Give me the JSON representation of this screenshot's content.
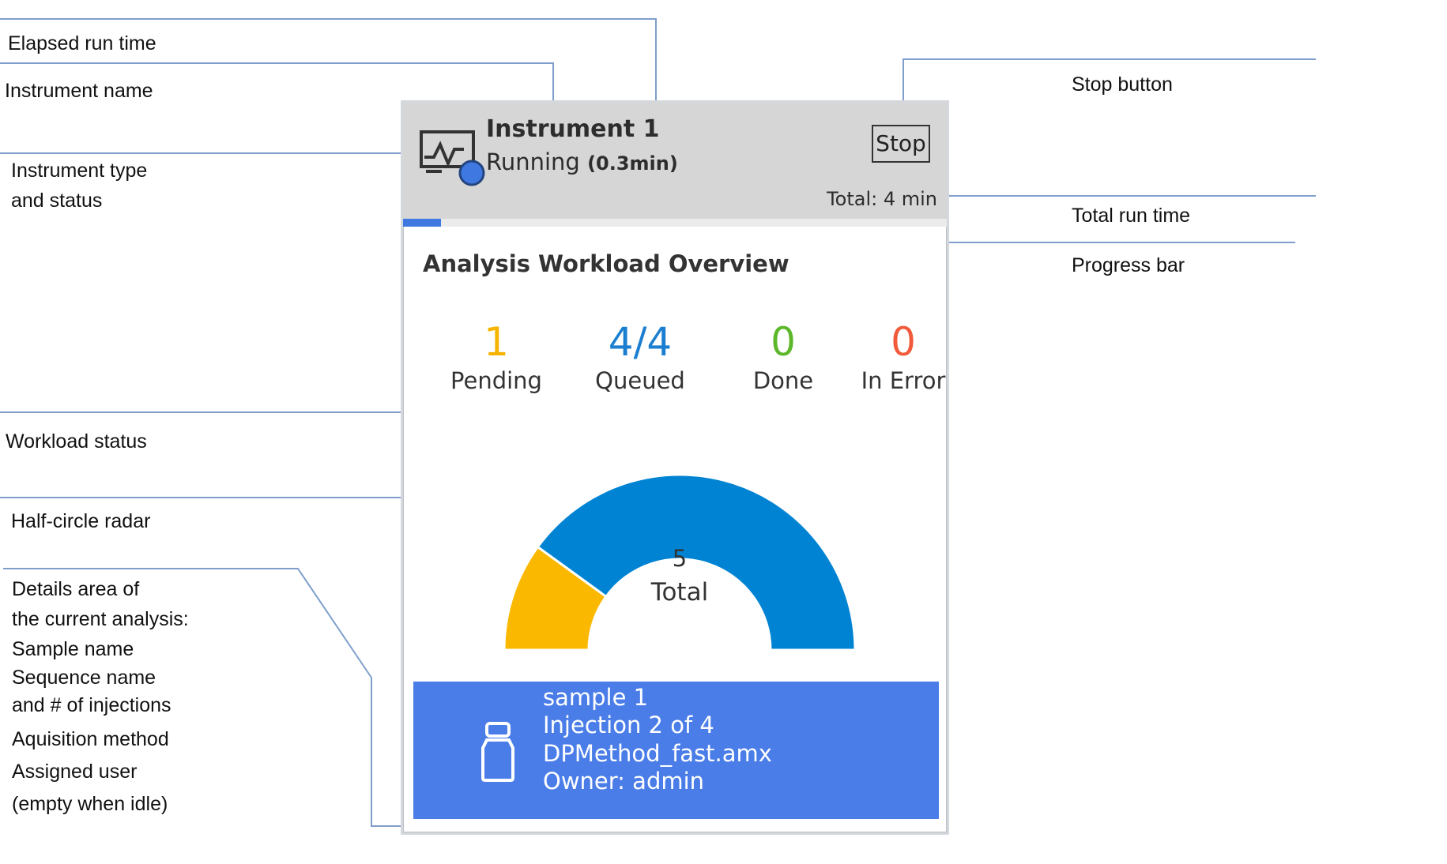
{
  "annotations": {
    "elapsed_run_time": "Elapsed run time",
    "instrument_name": "Instrument name",
    "instrument_type_status": [
      "Instrument type",
      "and status"
    ],
    "workload_status": "Workload status",
    "half_circle_radar": "Half-circle radar",
    "details_area": [
      "Details area of",
      "the current analysis:",
      "Sample name",
      "Sequence name",
      "and # of injections",
      "Aquisition method",
      "Assigned user",
      "(empty when idle)"
    ],
    "stop_button": "Stop button",
    "total_run_time": "Total run time",
    "progress_bar": "Progress bar"
  },
  "instrument": {
    "name": "Instrument 1",
    "status": "Running",
    "elapsed": "(0.3min)",
    "stop_label": "Stop",
    "total_time": "Total: 4 min",
    "progress": 0.07,
    "status_dot_color": "#3e78e0"
  },
  "workload": {
    "title": "Analysis Workload Overview",
    "stats": [
      {
        "value": "1",
        "label": "Pending",
        "color": "#f5b400"
      },
      {
        "value": "4/4",
        "label": "Queued",
        "color": "#1a7fd0"
      },
      {
        "value": "0",
        "label": "Done",
        "color": "#5cb82a"
      },
      {
        "value": "0",
        "label": "In Error",
        "color": "#f15a3a"
      }
    ],
    "gauge": {
      "total_value": "5",
      "total_label": "Total",
      "segments": [
        {
          "name": "Pending",
          "value": 1,
          "color": "#fbb800"
        },
        {
          "name": "Queued",
          "value": 4,
          "color": "#0083d3"
        }
      ]
    }
  },
  "details": {
    "sample": "sample 1",
    "injection": "Injection 2 of 4",
    "method": "DPMethod_fast.amx",
    "owner": "Owner: admin",
    "background": "#4a7de8"
  }
}
